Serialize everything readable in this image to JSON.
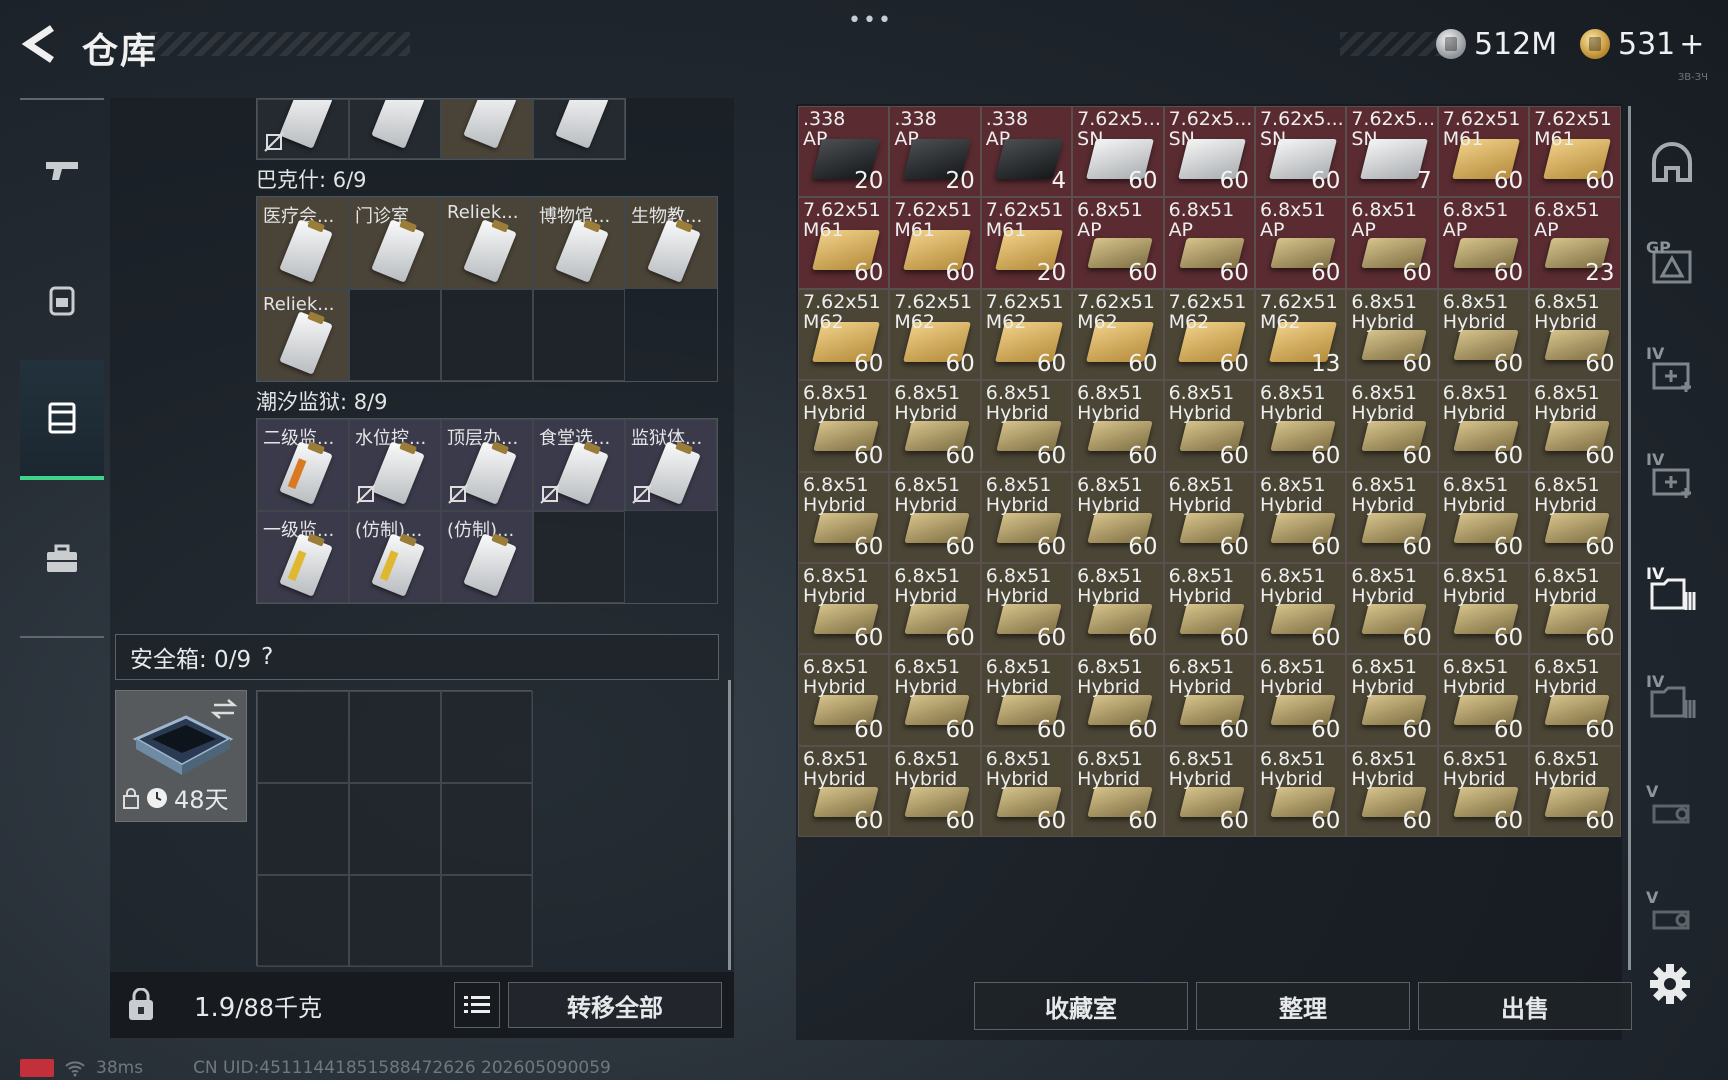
{
  "header": {
    "title": "仓库",
    "menu": "•••",
    "currency_silver": "512M",
    "currency_gold": "531",
    "currency_plus": "+",
    "corner_note": "ЗВ-ЗЧ"
  },
  "left_nav": [
    {
      "name": "weapon-tab",
      "icon": "pistol-icon"
    },
    {
      "name": "backpack-tab",
      "icon": "backpack-icon"
    },
    {
      "name": "container-tab",
      "icon": "container-icon",
      "active": true
    },
    {
      "name": "case-tab",
      "icon": "briefcase-icon"
    }
  ],
  "containers": {
    "bakshi_label": "巴克什: 6/9",
    "bakshi_items": [
      "医疗会...",
      "门诊室",
      "Reliek...",
      "博物馆...",
      "生物教...",
      "Reliek..."
    ],
    "tidal_label": "潮汐监狱: 8/9",
    "tidal_items": [
      "二级监...",
      "水位控...",
      "顶层办...",
      "食堂选...",
      "监狱体...",
      "一级监...",
      "(仿制)...",
      "(仿制)..."
    ]
  },
  "safe": {
    "label": "安全箱: 0/9",
    "help": "?",
    "timer": "48天"
  },
  "weight": {
    "current": "1.9",
    "max": "/88千克",
    "transfer_all": "转移全部"
  },
  "storage": {
    "items": [
      {
        "name": ".338\nAP",
        "count": "20",
        "bg": "red",
        "box": "black"
      },
      {
        "name": ".338\nAP",
        "count": "20",
        "bg": "red",
        "box": "black"
      },
      {
        "name": ".338\nAP",
        "count": "4",
        "bg": "red",
        "box": "black"
      },
      {
        "name": "7.62x5...\nSN",
        "count": "60",
        "bg": "red",
        "box": "white"
      },
      {
        "name": "7.62x5...\nSN",
        "count": "60",
        "bg": "red",
        "box": "white"
      },
      {
        "name": "7.62x5...\nSN",
        "count": "60",
        "bg": "red",
        "box": "white"
      },
      {
        "name": "7.62x5...\nSN",
        "count": "7",
        "bg": "red",
        "box": "white"
      },
      {
        "name": "7.62x51\nM61",
        "count": "60",
        "bg": "red",
        "box": "gold"
      },
      {
        "name": "7.62x51\nM61",
        "count": "60",
        "bg": "red",
        "box": "gold"
      },
      {
        "name": "7.62x51\nM61",
        "count": "60",
        "bg": "red",
        "box": "gold"
      },
      {
        "name": "7.62x51\nM61",
        "count": "60",
        "bg": "red",
        "box": "gold"
      },
      {
        "name": "7.62x51\nM61",
        "count": "20",
        "bg": "red",
        "box": "gold"
      },
      {
        "name": "6.8x51\nAP",
        "count": "60",
        "bg": "red",
        "box": "khaki"
      },
      {
        "name": "6.8x51\nAP",
        "count": "60",
        "bg": "red",
        "box": "khaki"
      },
      {
        "name": "6.8x51\nAP",
        "count": "60",
        "bg": "red",
        "box": "khaki"
      },
      {
        "name": "6.8x51\nAP",
        "count": "60",
        "bg": "red",
        "box": "khaki"
      },
      {
        "name": "6.8x51\nAP",
        "count": "60",
        "bg": "red",
        "box": "khaki"
      },
      {
        "name": "6.8x51\nAP",
        "count": "23",
        "bg": "red",
        "box": "khaki"
      },
      {
        "name": "7.62x51\nM62",
        "count": "60",
        "bg": "olive",
        "box": "gold"
      },
      {
        "name": "7.62x51\nM62",
        "count": "60",
        "bg": "olive",
        "box": "gold"
      },
      {
        "name": "7.62x51\nM62",
        "count": "60",
        "bg": "olive",
        "box": "gold"
      },
      {
        "name": "7.62x51\nM62",
        "count": "60",
        "bg": "olive",
        "box": "gold"
      },
      {
        "name": "7.62x51\nM62",
        "count": "60",
        "bg": "olive",
        "box": "gold"
      },
      {
        "name": "7.62x51\nM62",
        "count": "13",
        "bg": "olive",
        "box": "gold"
      },
      {
        "name": "6.8x51\nHybrid",
        "count": "60",
        "bg": "olive",
        "box": "khaki"
      },
      {
        "name": "6.8x51\nHybrid",
        "count": "60",
        "bg": "olive",
        "box": "khaki"
      },
      {
        "name": "6.8x51\nHybrid",
        "count": "60",
        "bg": "olive",
        "box": "khaki"
      },
      {
        "name": "6.8x51\nHybrid",
        "count": "60",
        "bg": "olive",
        "box": "khaki"
      },
      {
        "name": "6.8x51\nHybrid",
        "count": "60",
        "bg": "olive",
        "box": "khaki"
      },
      {
        "name": "6.8x51\nHybrid",
        "count": "60",
        "bg": "olive",
        "box": "khaki"
      },
      {
        "name": "6.8x51\nHybrid",
        "count": "60",
        "bg": "olive",
        "box": "khaki"
      },
      {
        "name": "6.8x51\nHybrid",
        "count": "60",
        "bg": "olive",
        "box": "khaki"
      },
      {
        "name": "6.8x51\nHybrid",
        "count": "60",
        "bg": "olive",
        "box": "khaki"
      },
      {
        "name": "6.8x51\nHybrid",
        "count": "60",
        "bg": "olive",
        "box": "khaki"
      },
      {
        "name": "6.8x51\nHybrid",
        "count": "60",
        "bg": "olive",
        "box": "khaki"
      },
      {
        "name": "6.8x51\nHybrid",
        "count": "60",
        "bg": "olive",
        "box": "khaki"
      },
      {
        "name": "6.8x51\nHybrid",
        "count": "60",
        "bg": "olive",
        "box": "khaki"
      },
      {
        "name": "6.8x51\nHybrid",
        "count": "60",
        "bg": "olive",
        "box": "khaki"
      },
      {
        "name": "6.8x51\nHybrid",
        "count": "60",
        "bg": "olive",
        "box": "khaki"
      },
      {
        "name": "6.8x51\nHybrid",
        "count": "60",
        "bg": "olive",
        "box": "khaki"
      },
      {
        "name": "6.8x51\nHybrid",
        "count": "60",
        "bg": "olive",
        "box": "khaki"
      },
      {
        "name": "6.8x51\nHybrid",
        "count": "60",
        "bg": "olive",
        "box": "khaki"
      },
      {
        "name": "6.8x51\nHybrid",
        "count": "60",
        "bg": "olive",
        "box": "khaki"
      },
      {
        "name": "6.8x51\nHybrid",
        "count": "60",
        "bg": "olive",
        "box": "khaki"
      },
      {
        "name": "6.8x51\nHybrid",
        "count": "60",
        "bg": "olive",
        "box": "khaki"
      },
      {
        "name": "6.8x51\nHybrid",
        "count": "60",
        "bg": "olive",
        "box": "khaki"
      },
      {
        "name": "6.8x51\nHybrid",
        "count": "60",
        "bg": "olive",
        "box": "khaki"
      },
      {
        "name": "6.8x51\nHybrid",
        "count": "60",
        "bg": "olive",
        "box": "khaki"
      },
      {
        "name": "6.8x51\nHybrid",
        "count": "60",
        "bg": "olive",
        "box": "khaki"
      },
      {
        "name": "6.8x51\nHybrid",
        "count": "60",
        "bg": "olive",
        "box": "khaki"
      },
      {
        "name": "6.8x51\nHybrid",
        "count": "60",
        "bg": "olive",
        "box": "khaki"
      },
      {
        "name": "6.8x51\nHybrid",
        "count": "60",
        "bg": "olive",
        "box": "khaki"
      },
      {
        "name": "6.8x51\nHybrid",
        "count": "60",
        "bg": "olive",
        "box": "khaki"
      },
      {
        "name": "6.8x51\nHybrid",
        "count": "60",
        "bg": "olive",
        "box": "khaki"
      },
      {
        "name": "6.8x51\nHybrid",
        "count": "60",
        "bg": "olive",
        "box": "khaki"
      },
      {
        "name": "6.8x51\nHybrid",
        "count": "60",
        "bg": "olive",
        "box": "khaki"
      },
      {
        "name": "6.8x51\nHybrid",
        "count": "60",
        "bg": "olive",
        "box": "khaki"
      },
      {
        "name": "6.8x51\nHybrid",
        "count": "60",
        "bg": "olive",
        "box": "khaki"
      },
      {
        "name": "6.8x51\nHybrid",
        "count": "60",
        "bg": "olive",
        "box": "khaki"
      },
      {
        "name": "6.8x51\nHybrid",
        "count": "60",
        "bg": "olive",
        "box": "khaki"
      },
      {
        "name": "6.8x51\nHybrid",
        "count": "60",
        "bg": "olive",
        "box": "khaki"
      },
      {
        "name": "6.8x51\nHybrid",
        "count": "60",
        "bg": "olive",
        "box": "khaki"
      },
      {
        "name": "6.8x51\nHybrid",
        "count": "60",
        "bg": "olive",
        "box": "khaki"
      },
      {
        "name": "6.8x51\nHybrid",
        "count": "60",
        "bg": "olive",
        "box": "khaki"
      },
      {
        "name": "6.8x51\nHybrid",
        "count": "60",
        "bg": "olive",
        "box": "khaki"
      },
      {
        "name": "6.8x51\nHybrid",
        "count": "60",
        "bg": "olive",
        "box": "khaki"
      },
      {
        "name": "6.8x51\nHybrid",
        "count": "60",
        "bg": "olive",
        "box": "khaki"
      },
      {
        "name": "6.8x51\nHybrid",
        "count": "60",
        "bg": "olive",
        "box": "khaki"
      },
      {
        "name": "6.8x51\nHybrid",
        "count": "60",
        "bg": "olive",
        "box": "khaki"
      },
      {
        "name": "6.8x51\nHybrid",
        "count": "60",
        "bg": "olive",
        "box": "khaki"
      },
      {
        "name": "6.8x51\nHybrid",
        "count": "60",
        "bg": "olive",
        "box": "khaki"
      },
      {
        "name": "6.8x51\nHybrid",
        "count": "60",
        "bg": "olive",
        "box": "khaki"
      }
    ]
  },
  "filters": [
    {
      "level": "",
      "icon": "helmet-icon"
    },
    {
      "level": "GP",
      "icon": "armor-plate-icon"
    },
    {
      "level": "IV",
      "icon": "medkit-icon"
    },
    {
      "level": "IV",
      "icon": "medkit-icon"
    },
    {
      "level": "IV",
      "icon": "ammo-folder-icon",
      "active": true
    },
    {
      "level": "IV",
      "icon": "ammo-folder-icon"
    },
    {
      "level": "V",
      "icon": "attachment-icon"
    },
    {
      "level": "V",
      "icon": "attachment-icon"
    }
  ],
  "actions": {
    "collection": "收藏室",
    "sort": "整理",
    "sell": "出售"
  },
  "status": {
    "ping": "38ms",
    "uid": "CN UID:451114418515884726​26 202605090059"
  },
  "colors": {
    "accent_green": "#3fd48a",
    "red_rarity": "#5a2c31",
    "olive_rarity": "#4b4535"
  }
}
